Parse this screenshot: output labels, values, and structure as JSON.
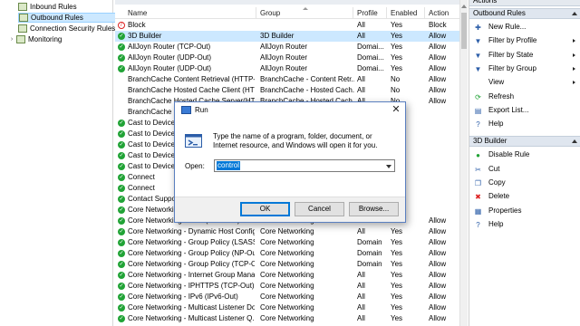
{
  "tree": {
    "items": [
      {
        "label": "Inbound Rules",
        "selected": false,
        "expander": ""
      },
      {
        "label": "Outbound Rules",
        "selected": true,
        "expander": ""
      },
      {
        "label": "Connection Security Rules",
        "selected": false,
        "expander": ""
      },
      {
        "label": "Monitoring",
        "selected": false,
        "expander": "›"
      }
    ]
  },
  "rules": {
    "section_title": "Outbound Rules",
    "columns": [
      "Name",
      "Group",
      "Profile",
      "Enabled",
      "Action"
    ],
    "rows": [
      {
        "status": "block",
        "name": "Block",
        "group": "",
        "profile": "All",
        "enabled": "Yes",
        "action": "Block"
      },
      {
        "status": "allow",
        "name": "3D Builder",
        "group": "3D Builder",
        "profile": "All",
        "enabled": "Yes",
        "action": "Allow",
        "selected": true
      },
      {
        "status": "allow",
        "name": "AllJoyn Router (TCP-Out)",
        "group": "AllJoyn Router",
        "profile": "Domai...",
        "enabled": "Yes",
        "action": "Allow"
      },
      {
        "status": "allow",
        "name": "AllJoyn Router (UDP-Out)",
        "group": "AllJoyn Router",
        "profile": "Domai...",
        "enabled": "Yes",
        "action": "Allow"
      },
      {
        "status": "allow",
        "name": "AllJoyn Router (UDP-Out)",
        "group": "AllJoyn Router",
        "profile": "Domai...",
        "enabled": "Yes",
        "action": "Allow"
      },
      {
        "status": "inactive",
        "name": "BranchCache Content Retrieval (HTTP-O...",
        "group": "BranchCache - Content Retr...",
        "profile": "All",
        "enabled": "No",
        "action": "Allow"
      },
      {
        "status": "inactive",
        "name": "BranchCache Hosted Cache Client (HTT...",
        "group": "BranchCache - Hosted Cach...",
        "profile": "All",
        "enabled": "No",
        "action": "Allow"
      },
      {
        "status": "inactive",
        "name": "BranchCache Hosted Cache Server(HTTP...",
        "group": "BranchCache - Hosted Cach...",
        "profile": "All",
        "enabled": "No",
        "action": "Allow"
      },
      {
        "status": "inactive",
        "name": "BranchCache Peer D...",
        "group": "",
        "profile": "",
        "enabled": "",
        "action": ""
      },
      {
        "status": "allow",
        "name": "Cast to Device fu",
        "group": "",
        "profile": "",
        "enabled": "",
        "action": ""
      },
      {
        "status": "allow",
        "name": "Cast to Device fu",
        "group": "",
        "profile": "",
        "enabled": "",
        "action": ""
      },
      {
        "status": "allow",
        "name": "Cast to Device s",
        "group": "",
        "profile": "",
        "enabled": "",
        "action": ""
      },
      {
        "status": "allow",
        "name": "Cast to Device s",
        "group": "",
        "profile": "",
        "enabled": "",
        "action": ""
      },
      {
        "status": "allow",
        "name": "Cast to Device s",
        "group": "",
        "profile": "",
        "enabled": "",
        "action": ""
      },
      {
        "status": "allow",
        "name": "Connect",
        "group": "",
        "profile": "",
        "enabled": "",
        "action": ""
      },
      {
        "status": "allow",
        "name": "Connect",
        "group": "",
        "profile": "",
        "enabled": "",
        "action": ""
      },
      {
        "status": "allow",
        "name": "Contact Suppo",
        "group": "",
        "profile": "",
        "enabled": "",
        "action": ""
      },
      {
        "status": "allow",
        "name": "Core Networking",
        "group": "",
        "profile": "",
        "enabled": "",
        "action": ""
      },
      {
        "status": "allow",
        "name": "Core Networking - DNS (UDP-Out)",
        "group": "Core Networking",
        "profile": "All",
        "enabled": "Yes",
        "action": "Allow"
      },
      {
        "status": "allow",
        "name": "Core Networking - Dynamic Host Config...",
        "group": "Core Networking",
        "profile": "All",
        "enabled": "Yes",
        "action": "Allow"
      },
      {
        "status": "allow",
        "name": "Core Networking - Group Policy (LSASS-...",
        "group": "Core Networking",
        "profile": "Domain",
        "enabled": "Yes",
        "action": "Allow"
      },
      {
        "status": "allow",
        "name": "Core Networking - Group Policy (NP-Out)",
        "group": "Core Networking",
        "profile": "Domain",
        "enabled": "Yes",
        "action": "Allow"
      },
      {
        "status": "allow",
        "name": "Core Networking - Group Policy (TCP-Out)",
        "group": "Core Networking",
        "profile": "Domain",
        "enabled": "Yes",
        "action": "Allow"
      },
      {
        "status": "allow",
        "name": "Core Networking - Internet Group Mana...",
        "group": "Core Networking",
        "profile": "All",
        "enabled": "Yes",
        "action": "Allow"
      },
      {
        "status": "allow",
        "name": "Core Networking - IPHTTPS (TCP-Out)",
        "group": "Core Networking",
        "profile": "All",
        "enabled": "Yes",
        "action": "Allow"
      },
      {
        "status": "allow",
        "name": "Core Networking - IPv6 (IPv6-Out)",
        "group": "Core Networking",
        "profile": "All",
        "enabled": "Yes",
        "action": "Allow"
      },
      {
        "status": "allow",
        "name": "Core Networking - Multicast Listener Do...",
        "group": "Core Networking",
        "profile": "All",
        "enabled": "Yes",
        "action": "Allow"
      },
      {
        "status": "allow",
        "name": "Core Networking - Multicast Listener Q...",
        "group": "Core Networking",
        "profile": "All",
        "enabled": "Yes",
        "action": "Allow"
      }
    ]
  },
  "actions": {
    "title": "Actions",
    "sections": [
      {
        "title": "Outbound Rules",
        "items": [
          {
            "icon": "new-rule-icon",
            "glyph": "✚",
            "label": "New Rule...",
            "submenu": false
          },
          {
            "icon": "filter-icon",
            "glyph": "▼",
            "label": "Filter by Profile",
            "submenu": true
          },
          {
            "icon": "filter-icon",
            "glyph": "▼",
            "label": "Filter by State",
            "submenu": true
          },
          {
            "icon": "filter-icon",
            "glyph": "▼",
            "label": "Filter by Group",
            "submenu": true
          },
          {
            "icon": "view-icon",
            "glyph": "",
            "label": "View",
            "submenu": true
          },
          {
            "icon": "refresh-icon",
            "glyph": "⟳",
            "label": "Refresh",
            "submenu": false
          },
          {
            "icon": "export-icon",
            "glyph": "▤",
            "label": "Export List...",
            "submenu": false
          },
          {
            "icon": "help-icon",
            "glyph": "?",
            "label": "Help",
            "submenu": false
          }
        ]
      },
      {
        "title": "3D Builder",
        "items": [
          {
            "icon": "disable-rule-icon",
            "glyph": "●",
            "label": "Disable Rule",
            "submenu": false
          },
          {
            "icon": "cut-icon",
            "glyph": "✂",
            "label": "Cut",
            "submenu": false
          },
          {
            "icon": "copy-icon",
            "glyph": "❐",
            "label": "Copy",
            "submenu": false
          },
          {
            "icon": "delete-icon",
            "glyph": "✖",
            "label": "Delete",
            "submenu": false
          },
          {
            "icon": "properties-icon",
            "glyph": "▦",
            "label": "Properties",
            "submenu": false
          },
          {
            "icon": "help-icon",
            "glyph": "?",
            "label": "Help",
            "submenu": false
          }
        ]
      }
    ]
  },
  "run_dialog": {
    "title": "Run",
    "close_glyph": "✕",
    "description": "Type the name of a program, folder, document, or Internet resource, and Windows will open it for you.",
    "open_label": "Open:",
    "input_value": "control",
    "buttons": {
      "ok": "OK",
      "cancel": "Cancel",
      "browse": "Browse..."
    }
  },
  "colors": {
    "allow": "#21a336",
    "block": "#dd2222",
    "selection": "#cce8ff",
    "accent": "#0078d7"
  }
}
